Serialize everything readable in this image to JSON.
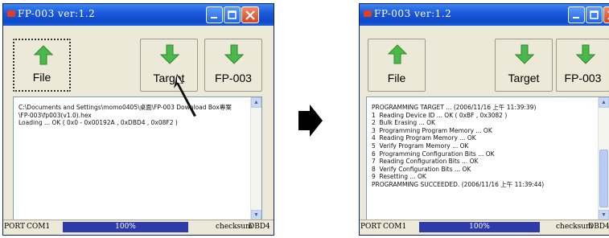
{
  "left_window": {
    "title": "FP-003   ver:1.2",
    "buttons": {
      "file": "File",
      "target": "Target",
      "device": "FP-003"
    },
    "log": "C:\\Documents and Settings\\momo0405\\桌面\\FP-003 Download Box專案\n\\FP-003\\fp003(v1.0).hex\nLoading ... OK ( 0x0 - 0x00192A , 0xDBD4 , 0x08F2 )",
    "status": {
      "port_label": "PORT",
      "port_value": "COM1",
      "progress": "100%",
      "progress_fraction": 1.0,
      "checksum_label": "checksum",
      "checksum_value": "DBD4"
    }
  },
  "right_window": {
    "title": "FP-003   ver:1.2",
    "buttons": {
      "file": "File",
      "target": "Target",
      "device": "FP-003"
    },
    "log": "PROGRAMMING TARGET ... (2006/11/16 上午 11:39:39)\n1  Reading Device ID ... OK ( 0xBF , 0x3082 )\n2  Bulk Erasing ... OK\n3  Programming Program Memory ... OK\n4  Reading Program Memory ... OK\n5  Verify Program Memory ... OK\n6  Programming Configuration Bits ... OK\n7  Reading Configuration Bits ... OK\n8  Verify Configuration Bits ... OK\n9  Resetting ... OK\nPROGRAMMING SUCCEEDED. (2006/11/16 上午 11:39:44)",
    "status": {
      "port_label": "PORT",
      "port_value": "COM1",
      "progress": "100%",
      "progress_fraction": 1.0,
      "checksum_label": "checksum",
      "checksum_value": "DBD4"
    }
  },
  "colors": {
    "titlebar": "#1a56d8",
    "progress": "#2f3ba8",
    "green_arrow": "#4bb84b",
    "window_bg": "#ece9d8"
  },
  "icons": [
    "up-arrow-icon",
    "down-arrow-icon",
    "minimize-icon",
    "maximize-icon",
    "close-icon",
    "cursor-arrow-icon",
    "transition-arrow-icon"
  ]
}
